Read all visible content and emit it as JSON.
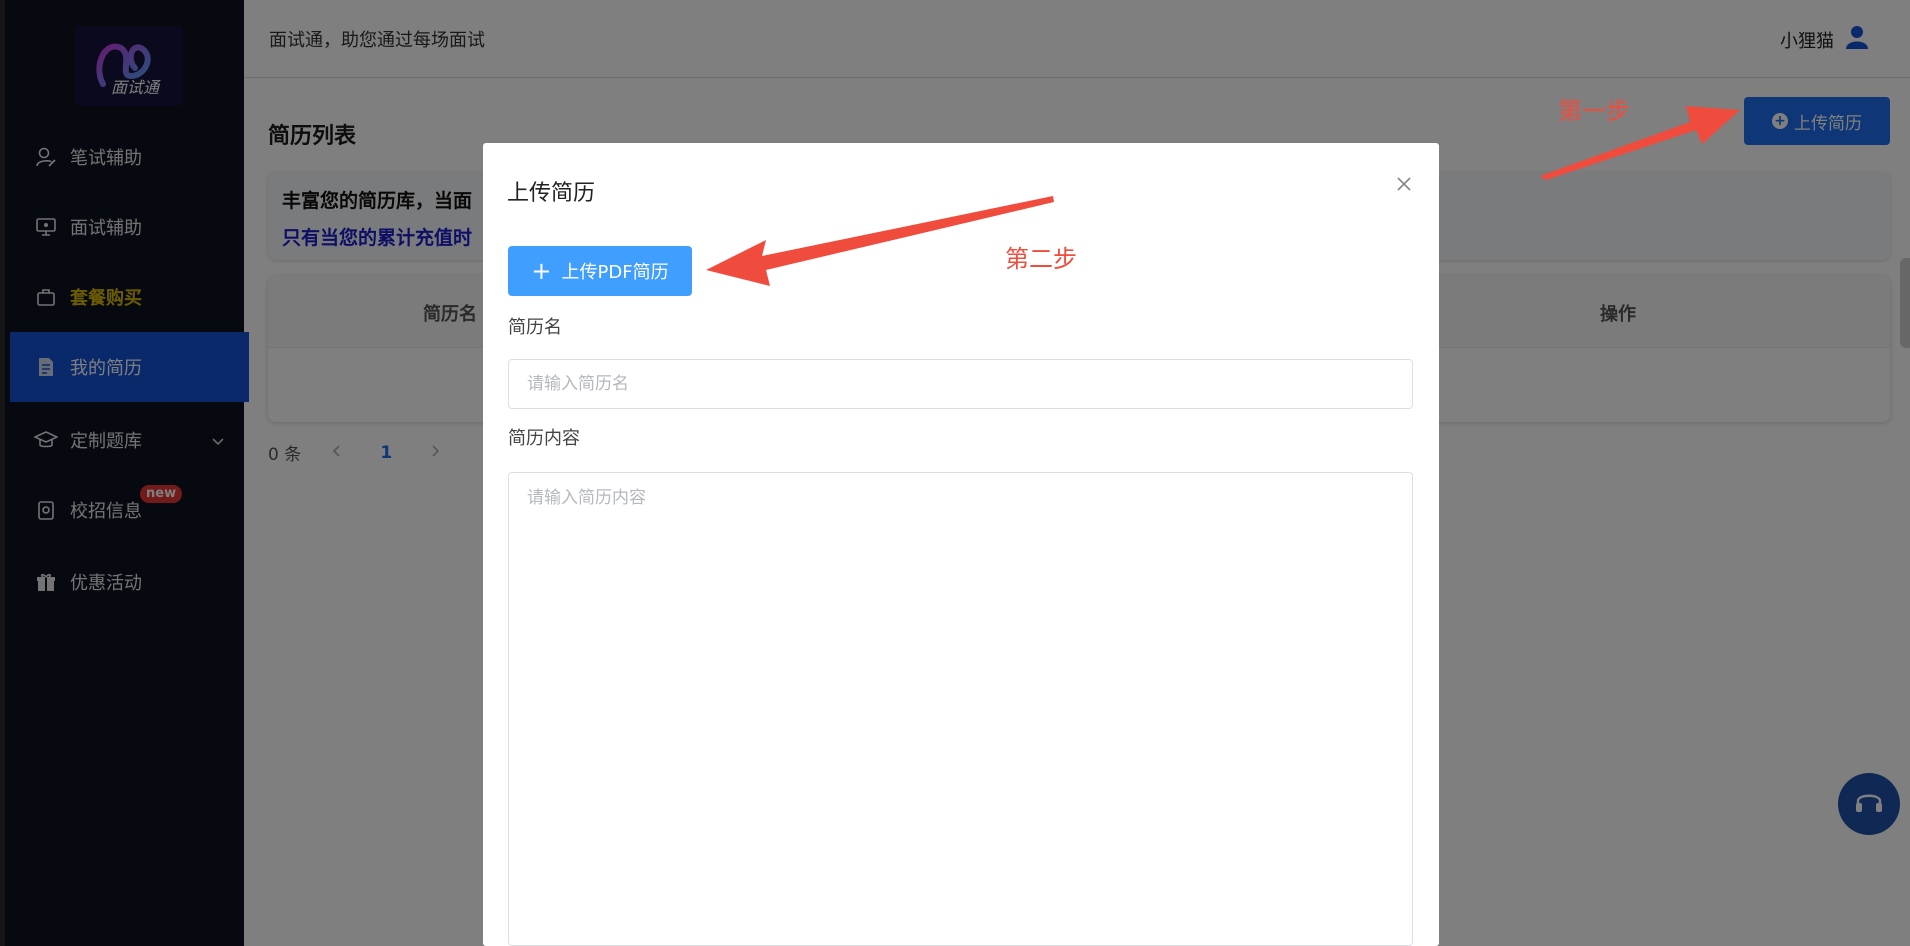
{
  "header": {
    "slogan": "面试通，助您通过每场面试",
    "username": "小狸猫"
  },
  "logo": {
    "text": "面试通"
  },
  "sidebar": {
    "items": [
      {
        "label": "笔试辅助",
        "icon": "user-edit-icon"
      },
      {
        "label": "面试辅助",
        "icon": "monitor-icon"
      },
      {
        "label": "套餐购买",
        "icon": "bag-icon"
      },
      {
        "label": "我的简历",
        "icon": "document-icon"
      },
      {
        "label": "定制题库",
        "icon": "graduation-cap-icon"
      },
      {
        "label": "校招信息",
        "icon": "badge-icon",
        "badge": "new"
      },
      {
        "label": "优惠活动",
        "icon": "gift-icon"
      }
    ],
    "active_index": 3
  },
  "main": {
    "title": "简历列表",
    "upload_button": "上传简历",
    "info_line1": "丰富您的简历库，当面",
    "info_line2": "只有当您的累计充值时",
    "table": {
      "columns": [
        "简历名",
        "操作"
      ]
    },
    "pagination": {
      "total": "0 条",
      "current_page": "1"
    }
  },
  "modal": {
    "title": "上传简历",
    "pdf_button": "上传PDF简历",
    "name_label": "简历名",
    "name_placeholder": "请输入简历名",
    "content_label": "简历内容",
    "content_placeholder": "请输入简历内容"
  },
  "annotations": {
    "step1": "第一步",
    "step2": "第二步"
  },
  "colors": {
    "sidebar_bg": "#0f1322",
    "active": "#1452d6",
    "primary": "#409eff",
    "annotation": "#f04c3e",
    "highlight": "#d9b800"
  }
}
